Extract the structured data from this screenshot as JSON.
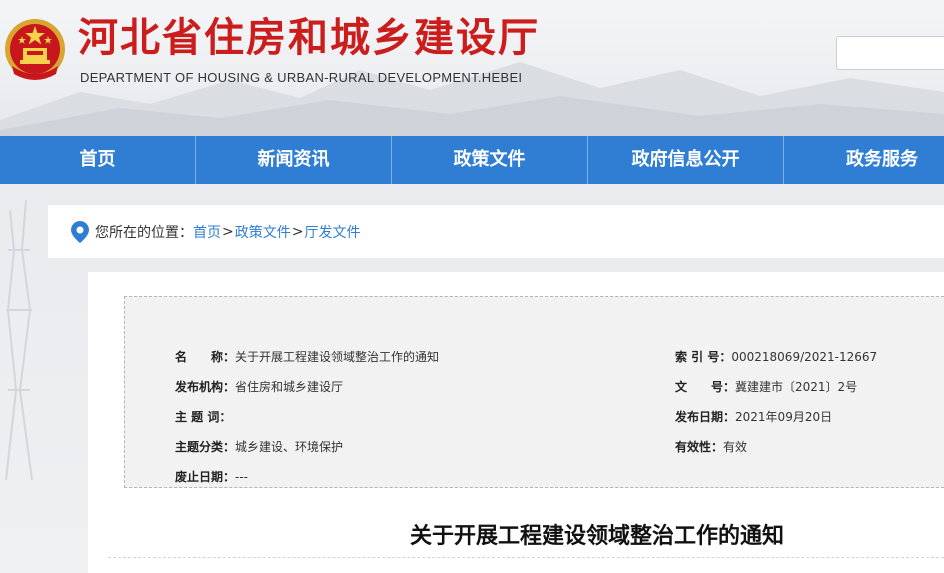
{
  "header": {
    "title": "河北省住房和城乡建设厅",
    "subtitle": "DEPARTMENT OF HOUSING & URBAN-RURAL DEVELOPMENT.HEBEI",
    "search_value": ""
  },
  "nav": {
    "items": [
      "首页",
      "新闻资讯",
      "政策文件",
      "政府信息公开",
      "政务服务"
    ]
  },
  "breadcrumb": {
    "prefix": "您所在的位置：",
    "links": [
      "首页",
      "政策文件",
      "厅发文件"
    ],
    "separator": ">"
  },
  "meta": {
    "name_label": "名　　称：",
    "name_value": "关于开展工程建设领域整治工作的通知",
    "org_label": "发布机构：",
    "org_value": "省住房和城乡建设厅",
    "keywords_label": "主 题 词：",
    "keywords_value": "",
    "category_label": "主题分类：",
    "category_value": "城乡建设、环境保护",
    "expiry_label": "废止日期：",
    "expiry_value": "---",
    "index_label": "索 引 号：",
    "index_value": "000218069/2021-12667",
    "docno_label": "文　　号：",
    "docno_value": "冀建建市〔2021〕2号",
    "date_label": "发布日期：",
    "date_value": "2021年09月20日",
    "validity_label": "有效性：",
    "validity_value": "有效"
  },
  "document": {
    "title": "关于开展工程建设领域整治工作的通知"
  },
  "colors": {
    "brand_red": "#cc1d1d",
    "nav_blue": "#2f7ed4",
    "link_blue": "#2f7ed4"
  }
}
